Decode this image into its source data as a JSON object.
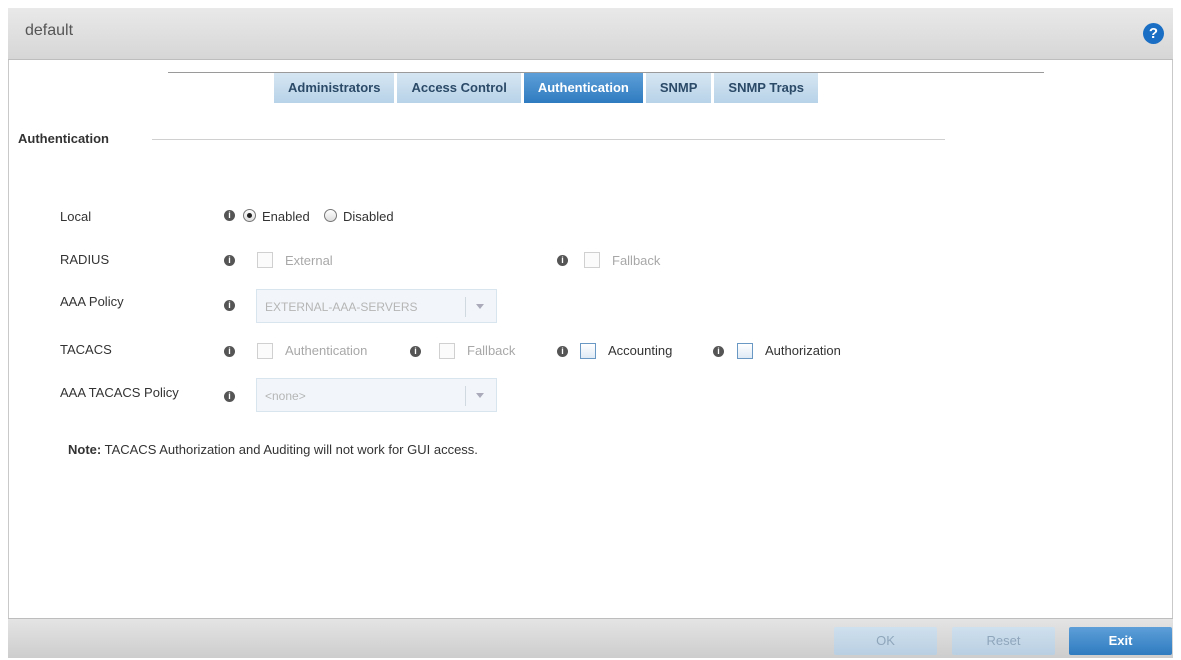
{
  "header": {
    "title": "default",
    "help": "?"
  },
  "tabs": [
    {
      "label": "Administrators"
    },
    {
      "label": "Access Control"
    },
    {
      "label": "Authentication"
    },
    {
      "label": "SNMP"
    },
    {
      "label": "SNMP Traps"
    }
  ],
  "section": {
    "title": "Authentication"
  },
  "fields": {
    "local": {
      "label": "Local",
      "enabled_label": "Enabled",
      "disabled_label": "Disabled",
      "selected": "Enabled"
    },
    "radius": {
      "label": "RADIUS",
      "external_label": "External",
      "fallback_label": "Fallback"
    },
    "aaa_policy": {
      "label": "AAA Policy",
      "value": "EXTERNAL-AAA-SERVERS"
    },
    "tacacs": {
      "label": "TACACS",
      "authentication_label": "Authentication",
      "fallback_label": "Fallback",
      "accounting_label": "Accounting",
      "authorization_label": "Authorization"
    },
    "aaa_tacacs_policy": {
      "label": "AAA TACACS Policy",
      "value": "<none>"
    }
  },
  "note": {
    "prefix": "Note:",
    "text": " TACACS Authorization and Auditing will not work for GUI access."
  },
  "footer": {
    "ok": "OK",
    "reset": "Reset",
    "exit": "Exit"
  },
  "colors": {
    "accent": "#2f7bc0",
    "tab_inactive": "#c6dcee",
    "info_icon": "#555555"
  },
  "icons": {
    "info": "info-icon",
    "help": "help-icon"
  }
}
